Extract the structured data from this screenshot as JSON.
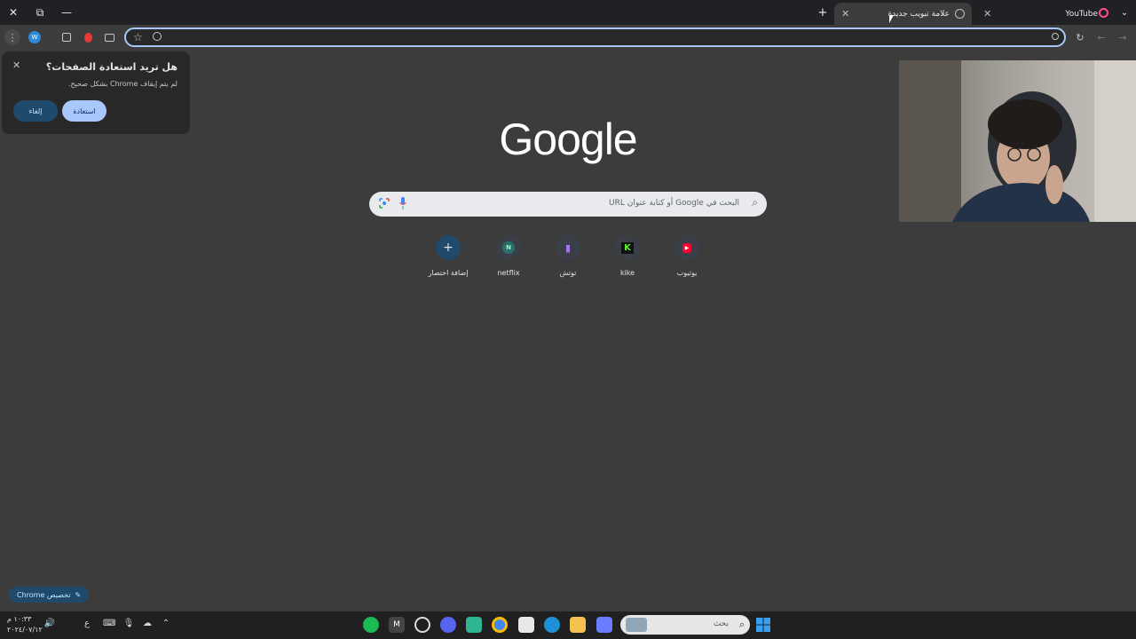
{
  "window": {
    "close_glyph": "✕",
    "restore_glyph": "⧉",
    "minimize_glyph": "—"
  },
  "tabs": [
    {
      "label": "YouTube",
      "close": "✕"
    },
    {
      "label": "علامة تبويب جديدة",
      "close": "✕",
      "active": true
    }
  ],
  "new_tab_glyph": "+",
  "toolbar": {
    "menu_glyph": "⋮",
    "profile_initial": "W",
    "star_glyph": "☆",
    "reload_glyph": "↻",
    "back_glyph": "←",
    "forward_glyph": "→"
  },
  "restore_popup": {
    "title": "هل تريد استعادة الصفحات؟",
    "subtitle": "لم يتم إيقاف Chrome بشكل صحيح.",
    "restore_label": "استعادة",
    "cancel_label": "إلغاء",
    "close_glyph": "✕"
  },
  "logo_text": "Google",
  "search": {
    "placeholder": "البحث في Google أو كتابة عنوان URL"
  },
  "shortcuts": [
    {
      "label": "يوتيوب",
      "icon": "youtube-icon",
      "glyph": "▶",
      "color": "#ff0033"
    },
    {
      "label": "kike",
      "icon": "kick-icon",
      "glyph": "K",
      "color": "#53fc18"
    },
    {
      "label": "توتش",
      "icon": "twitch-icon",
      "glyph": "▮",
      "color": "#a970ff"
    },
    {
      "label": "netflix",
      "icon": "n-letter-icon",
      "glyph": "N",
      "color": "#4fd1c5"
    },
    {
      "label": "إضافة اختصار",
      "icon": "plus-icon",
      "glyph": "+",
      "color": "#e3e3e3"
    }
  ],
  "customize_label": "تخصيص Chrome",
  "taskbar": {
    "search_text": "بحث",
    "clock_time": "١٠:٣٣ م",
    "clock_date": "٢٠٢٤/٠٧/١٢",
    "lang": "ع"
  }
}
